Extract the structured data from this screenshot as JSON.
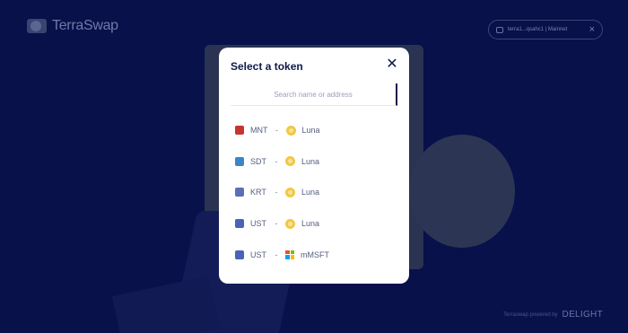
{
  "header": {
    "logo_text": "TerraSwap",
    "logo_sub": "",
    "wallet_text": "terra1...qsahc1 | Mainnet"
  },
  "footer": {
    "powered_text": "Terraswap powered by",
    "brand": "DELIGHT"
  },
  "modal": {
    "title": "Select a token",
    "search_placeholder": "Search name or address",
    "pairs": [
      {
        "token": "MNT",
        "token_icon": "mnt-icon",
        "token_color": "#c6342e",
        "separator": "-",
        "pair": "Luna",
        "pair_icon": "luna-icon"
      },
      {
        "token": "SDT",
        "token_icon": "sdt-icon",
        "token_color": "#3a86c8",
        "separator": "-",
        "pair": "Luna",
        "pair_icon": "luna-icon"
      },
      {
        "token": "KRT",
        "token_icon": "krt-icon",
        "token_color": "#5b6fb5",
        "separator": "-",
        "pair": "Luna",
        "pair_icon": "luna-icon"
      },
      {
        "token": "UST",
        "token_icon": "ust-icon",
        "token_color": "#4a62b8",
        "separator": "-",
        "pair": "Luna",
        "pair_icon": "luna-icon"
      },
      {
        "token": "UST",
        "token_icon": "ust-icon",
        "token_color": "#4a62b8",
        "separator": "-",
        "pair": "mMSFT",
        "pair_icon": "msft-icon"
      }
    ]
  },
  "colors": {
    "background": "#08114a",
    "modal_title": "#0f1a4c",
    "luna": "#f2c742"
  }
}
